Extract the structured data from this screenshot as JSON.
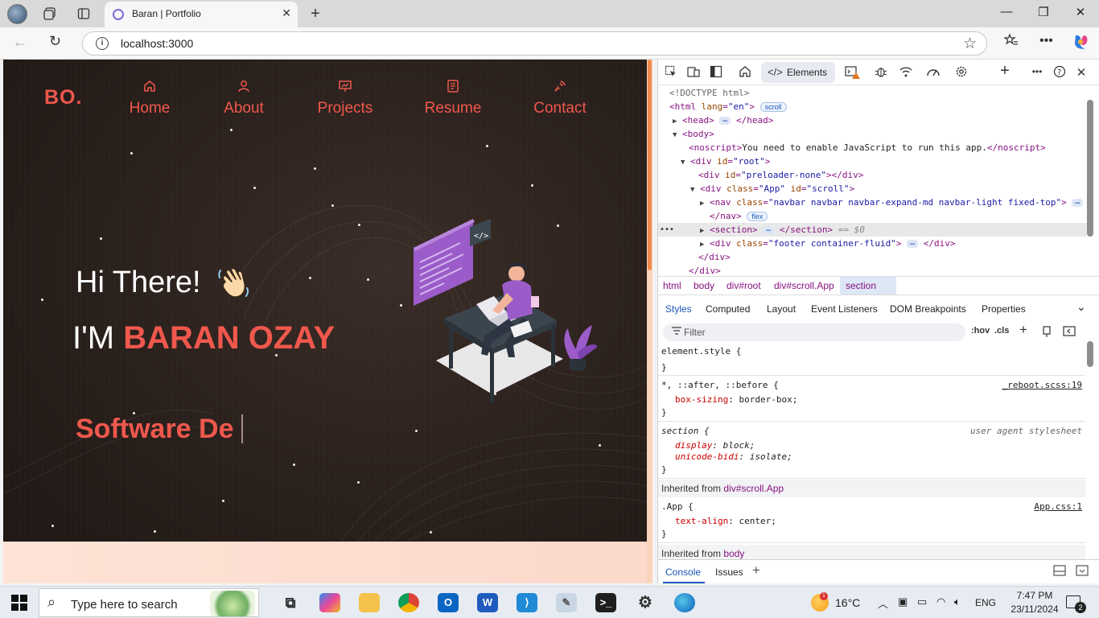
{
  "browser": {
    "tab_title": "Baran | Portfolio",
    "url": "localhost:3000",
    "new_tab_symbol": "+",
    "minimize_symbol": "—",
    "maximize_symbol": "❐",
    "close_symbol": "✕"
  },
  "site": {
    "logo": "BO.",
    "nav": [
      {
        "label": "Home",
        "icon": "home-icon"
      },
      {
        "label": "About",
        "icon": "user-icon"
      },
      {
        "label": "Projects",
        "icon": "presentation-icon"
      },
      {
        "label": "Resume",
        "icon": "document-icon"
      },
      {
        "label": "Contact",
        "icon": "satellite-icon"
      }
    ],
    "greeting": "Hi There!",
    "name_prefix": "I'M",
    "name": "BARAN OZAY",
    "typing_text": "Software De"
  },
  "devtools": {
    "elements_tab": "Elements",
    "dom": {
      "doctype": "<!DOCTYPE html>",
      "html_open": "<html ",
      "html_lang_attr": "lang",
      "html_lang_val": "\"en\"",
      "html_close": ">",
      "scroll_badge": "scroll",
      "head": "<head>",
      "head_close": "</head>",
      "body": "<body>",
      "noscript_open": "<noscript>",
      "noscript_text": "You need to enable JavaScript to run this app.",
      "noscript_close": "</noscript>",
      "div_root_open": "<div ",
      "id_attr": "id",
      "root_val": "\"root\"",
      "preloader_val": "\"preloader-none\"",
      "div_close_tag": "></div>",
      "class_attr": "class",
      "app_val": "\"App\"",
      "scroll_val": "\"scroll\"",
      "nav_open": "<nav ",
      "nav_class_val": "\"navbar navbar navbar-expand-md navbar-light fixed-top\"",
      "nav_close": "</nav>",
      "flex_badge": "flex",
      "section_open": "<section>",
      "section_close": "</section>",
      "dollar0": "== $0",
      "footer_class_val": "\"footer container-fluid\"",
      "div_end": "</div>",
      "gt": ">"
    },
    "breadcrumbs": [
      "html",
      "body",
      "div#root",
      "div#scroll.App",
      "section"
    ],
    "style_tabs": [
      "Styles",
      "Computed",
      "Layout",
      "Event Listeners",
      "DOM Breakpoints",
      "Properties"
    ],
    "filter_placeholder": "Filter",
    "filter_tools": [
      ":hov",
      ".cls"
    ],
    "rules": {
      "element_style": "element.style {",
      "close_brace": "}",
      "universal_selector": "*, ::after, ::before {",
      "universal_source": "_reboot.scss:19",
      "box_sizing_prop": "box-sizing",
      "box_sizing_val": "border-box;",
      "section_selector": "section {",
      "section_source": "user agent stylesheet",
      "display_prop": "display",
      "display_val": "block;",
      "unicode_prop": "unicode-bidi",
      "unicode_val": "isolate;",
      "inherited_label": "Inherited from",
      "inherited_app": "div#scroll.App",
      "app_selector": ".App {",
      "app_source": "App.css:1",
      "text_align_prop": "text-align",
      "text_align_val": "center;",
      "inherited_body": "body"
    },
    "drawer_tabs": [
      "Console",
      "Issues"
    ]
  },
  "taskbar": {
    "search_placeholder": "Type here to search",
    "temperature": "16°C",
    "language": "ENG",
    "time": "7:47 PM",
    "date": "23/11/2024",
    "weather_badge": "1",
    "notification_count": "2"
  },
  "colors": {
    "accent": "#f0584d",
    "devtools_blue": "#1a56b8"
  }
}
